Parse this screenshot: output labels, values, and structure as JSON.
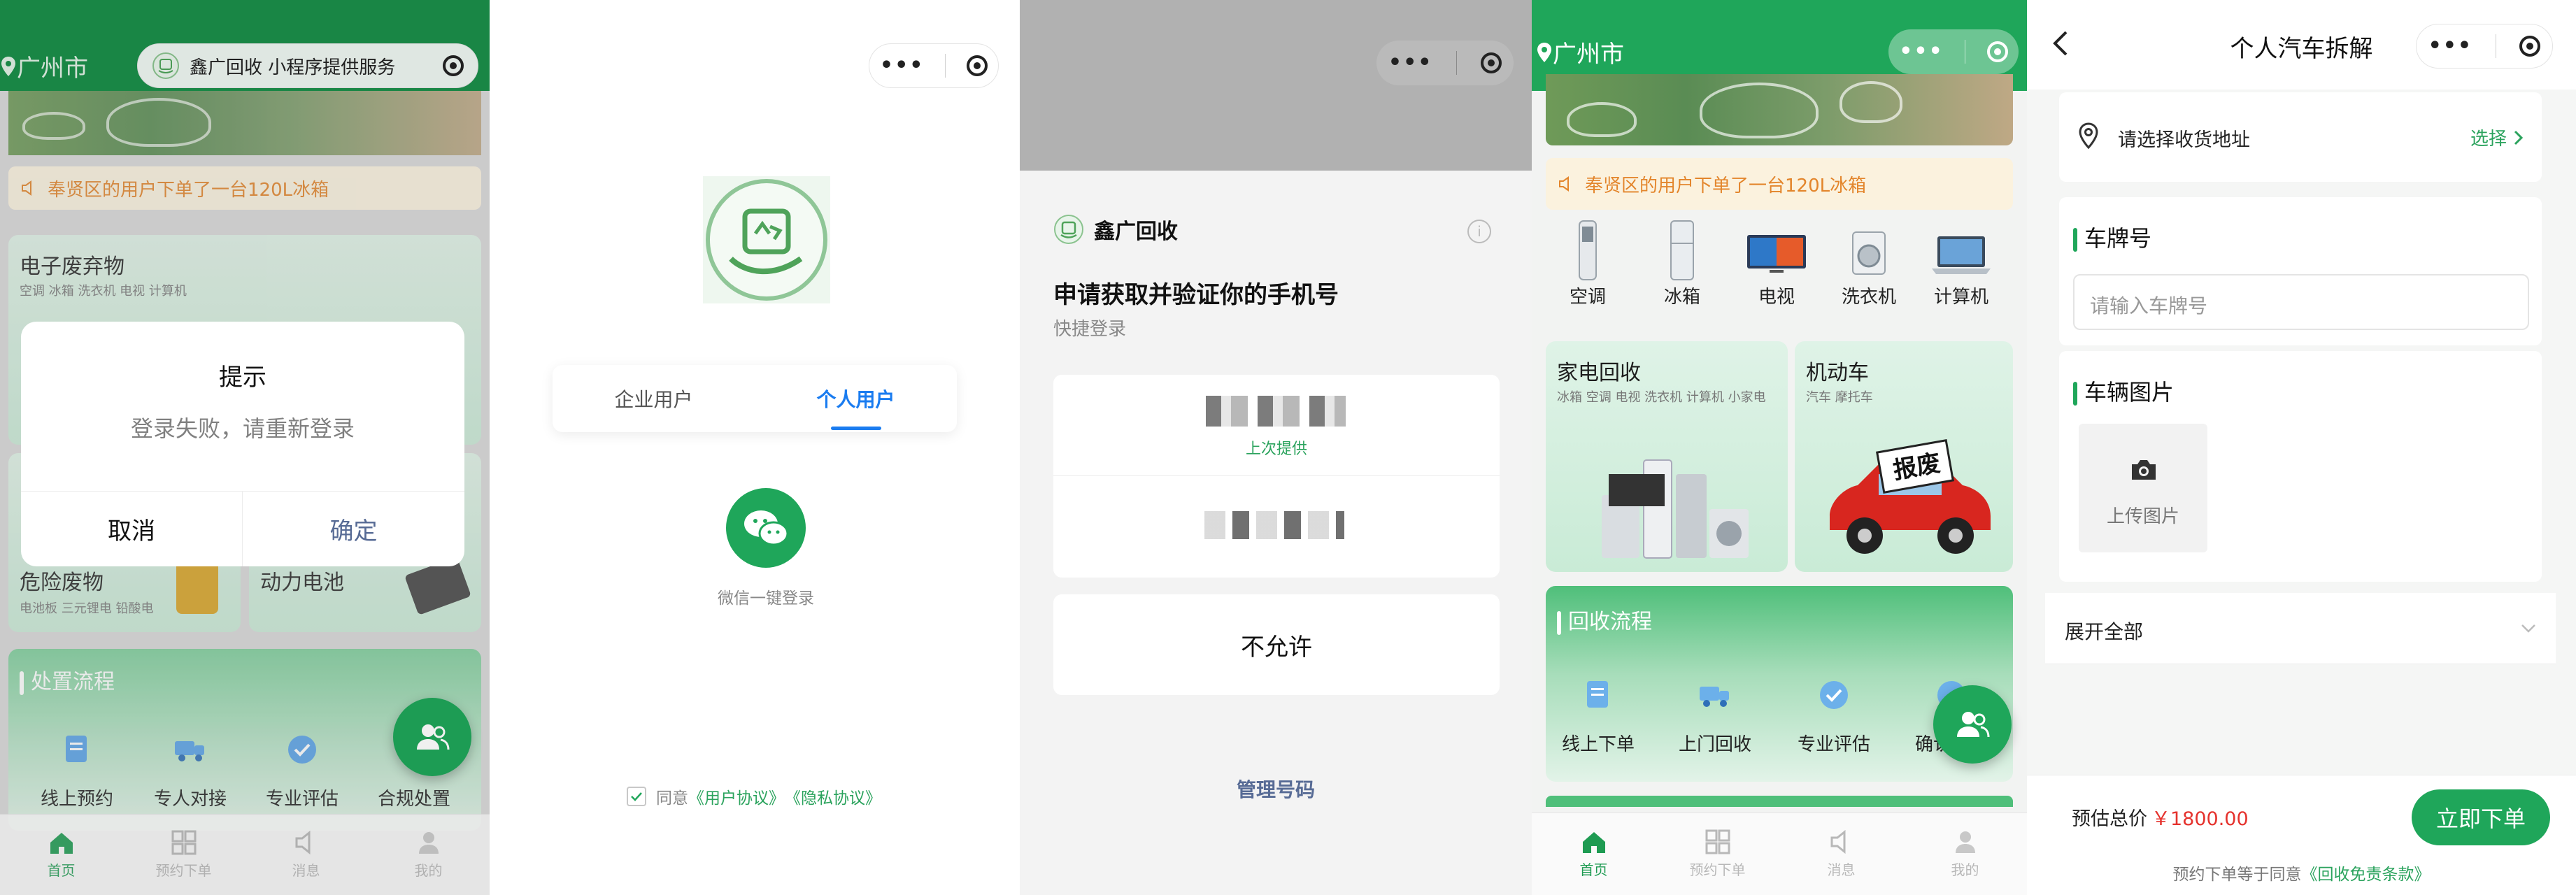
{
  "colors": {
    "brand_green": "#1fa65a",
    "price_red": "#e5322d",
    "notice_orange": "#e3852b",
    "link_green": "#2ba35d"
  },
  "p1": {
    "city": "广州市",
    "service_label": "鑫广回收 小程序提供服务",
    "notice": "奉贤区的用户下单了一台120L冰箱",
    "cat1_title": "电子废弃物",
    "cat1_sub": "空调 冰箱 洗衣机 电视 计算机",
    "cat2_title": "危险废物",
    "cat2_sub": "电池板 三元锂电 铅酸电",
    "cat3_title": "动力电池",
    "flow_title": "处置流程",
    "flow_steps": [
      "线上预约",
      "专人对接",
      "专业评估",
      "合规处置"
    ],
    "dialog": {
      "title": "提示",
      "message": "登录失败，请重新登录",
      "cancel": "取消",
      "confirm": "确定"
    },
    "tabs": [
      "首页",
      "预约下单",
      "消息",
      "我的"
    ]
  },
  "p2": {
    "tab_enterprise": "企业用户",
    "tab_personal": "个人用户",
    "wechat_login": "微信一键登录",
    "agree_prefix": "同意",
    "user_agreement": "《用户协议》",
    "privacy_agreement": "《隐私协议》"
  },
  "p3": {
    "app_name": "鑫广回收",
    "heading": "申请获取并验证你的手机号",
    "subheading": "快捷登录",
    "last_used": "上次提供",
    "deny": "不允许",
    "manage": "管理号码"
  },
  "p4": {
    "city": "广州市",
    "notice": "奉贤区的用户下单了一台120L冰箱",
    "categories": [
      "空调",
      "冰箱",
      "电视",
      "洗衣机",
      "计算机"
    ],
    "card1_title": "家电回收",
    "card1_sub": "冰箱 空调 电视 洗衣机 计算机 小家电",
    "card2_title": "机动车",
    "card2_sub": "汽车 摩托车",
    "scrap_label": "报废",
    "flow_title": "回收流程",
    "flow_steps": [
      "线上下单",
      "上门回收",
      "专业评估",
      "确认回收"
    ],
    "tabs": [
      "首页",
      "预约下单",
      "消息",
      "我的"
    ]
  },
  "p5": {
    "title": "个人汽车拆解",
    "address_placeholder": "请选择收货地址",
    "select_label": "选择",
    "plate_label": "车牌号",
    "plate_placeholder": "请输入车牌号",
    "images_label": "车辆图片",
    "upload_label": "上传图片",
    "expand_label": "展开全部",
    "estimate_label": "预估总价",
    "price": "￥1800.00",
    "order_button": "立即下单",
    "terms_prefix": "预约下单等于同意",
    "terms_link": "《回收免责条款》"
  }
}
